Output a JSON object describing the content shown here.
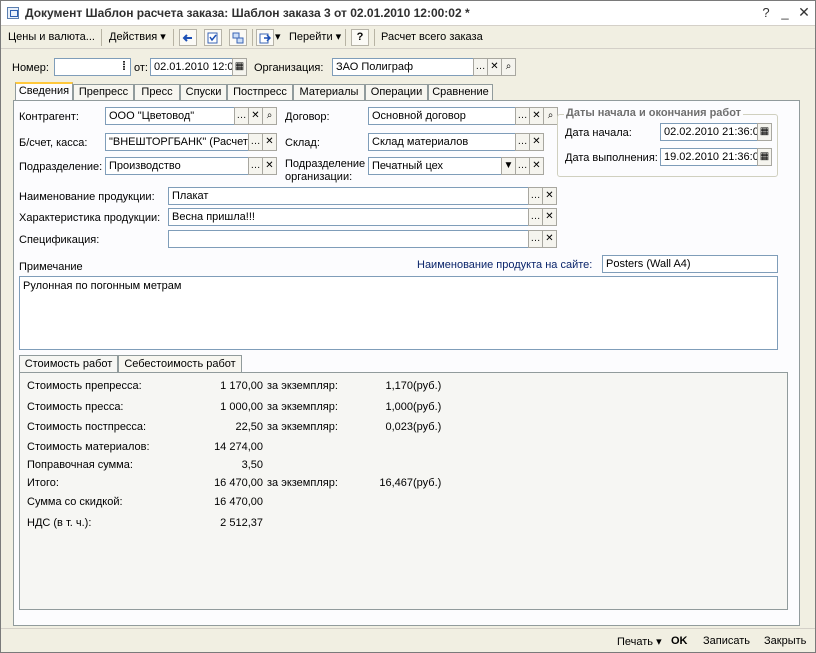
{
  "window": {
    "title": "Документ Шаблон расчета заказа: Шаблон заказа 3 от 02.01.2010 12:00:02 *"
  },
  "toolbar": {
    "prices": "Цены и валюта...",
    "actions": "Действия",
    "goto": "Перейти",
    "help": "?",
    "calc_all": "Расчет всего заказа"
  },
  "header": {
    "number_label": "Номер:",
    "number_value": "",
    "date_label": "от:",
    "date_value": "02.01.2010 12:0",
    "org_label": "Организация:",
    "org_value": "ЗАО Полиграф"
  },
  "tabs": [
    "Сведения",
    "Препресс",
    "Пресс",
    "Спуски",
    "Постпресс",
    "Материалы",
    "Операции",
    "Сравнение"
  ],
  "form": {
    "contractor_label": "Контрагент:",
    "contractor_value": "ООО \"Цветовод\"",
    "account_label": "Б/счет, касса:",
    "account_value": "\"ВНЕШТОРГБАНК\" (Расчет",
    "division_label": "Подразделение:",
    "division_value": "Производство",
    "contract_label": "Договор:",
    "contract_value": "Основной договор",
    "warehouse_label": "Склад:",
    "warehouse_value": "Склад материалов",
    "org_division_label": "Подразделение организации:",
    "org_division_value": "Печатный цех",
    "product_name_label": "Наименование продукции:",
    "product_name_value": "Плакат",
    "product_char_label": "Характеристика продукции:",
    "product_char_value": "Весна пришла!!!",
    "spec_label": "Спецификация:",
    "spec_value": "",
    "note_label": "Примечание",
    "note_value": "Рулонная по погонным метрам",
    "site_name_label": "Наименование продукта на сайте:",
    "site_name_value": "Posters (Wall A4)"
  },
  "dates": {
    "group_title": "Даты начала и окончания работ",
    "start_label": "Дата начала:",
    "start_value": "02.02.2010 21:36:0",
    "end_label": "Дата выполнения:",
    "end_value": "19.02.2010 21:36:0"
  },
  "inner_tabs": [
    "Стоимость работ",
    "Себестоимость работ"
  ],
  "costs": [
    {
      "label": "Стоимость препресса:",
      "value": "1 170,00",
      "per_label": "за экземпляр:",
      "per_value": "1,170",
      "unit": "(руб.)"
    },
    {
      "label": "Стоимость пресса:",
      "value": "1 000,00",
      "per_label": "за экземпляр:",
      "per_value": "1,000",
      "unit": "(руб.)"
    },
    {
      "label": "Стоимость постпресса:",
      "value": "22,50",
      "per_label": "за экземпляр:",
      "per_value": "0,023",
      "unit": "(руб.)"
    },
    {
      "label": "Стоимость материалов:",
      "value": "14 274,00"
    },
    {
      "label": "Поправочная сумма:",
      "value": "3,50"
    },
    {
      "label": "Итого:",
      "value": "16 470,00",
      "per_label": "за экземпляр:",
      "per_value": "16,467",
      "unit": "(руб.)"
    },
    {
      "label": "Сумма со скидкой:",
      "value": "16 470,00"
    },
    {
      "label": "НДС (в т. ч.):",
      "value": "2 512,37"
    }
  ],
  "footer": {
    "print": "Печать",
    "ok": "OK",
    "save": "Записать",
    "close": "Закрыть"
  }
}
